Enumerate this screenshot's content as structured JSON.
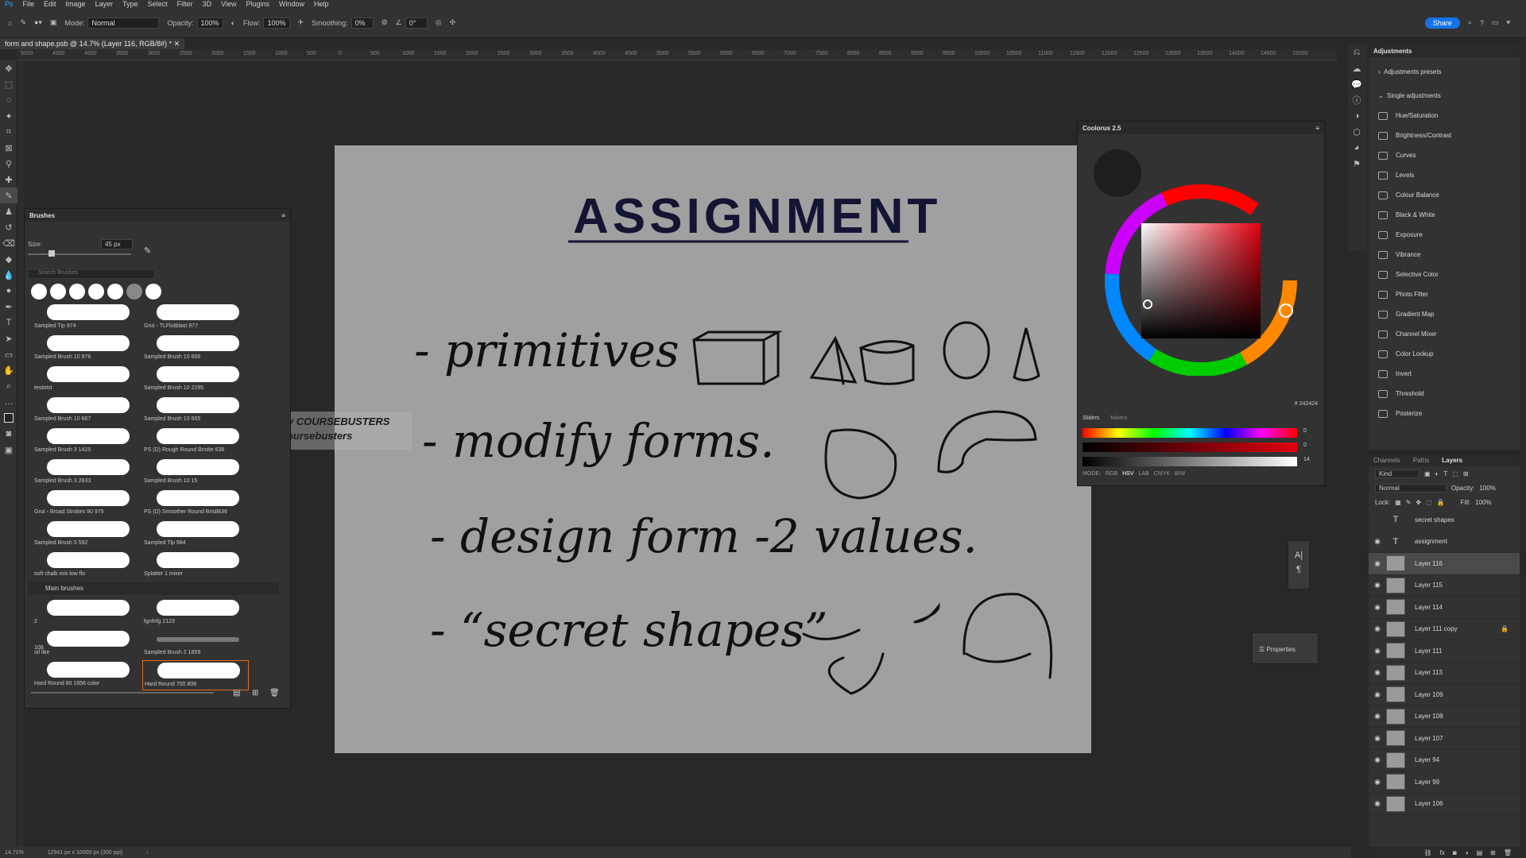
{
  "menu": [
    "File",
    "Edit",
    "Image",
    "Layer",
    "Type",
    "Select",
    "Filter",
    "3D",
    "View",
    "Plugins",
    "Window",
    "Help"
  ],
  "options": {
    "mode_label": "Mode:",
    "mode_value": "Normal",
    "opacity_label": "Opacity:",
    "opacity_value": "100%",
    "flow_label": "Flow:",
    "flow_value": "100%",
    "smoothing_label": "Smoothing:",
    "smoothing_value": "0%",
    "angle_value": "0°",
    "share_label": "Share"
  },
  "document_tab": "form and shape.psb @ 14.7% (Layer 116, RGB/8#) *",
  "ruler_ticks": [
    "5000",
    "4500",
    "4000",
    "3500",
    "3000",
    "2500",
    "2000",
    "1500",
    "1000",
    "500",
    "0",
    "500",
    "1000",
    "1500",
    "2000",
    "2500",
    "3000",
    "3500",
    "4000",
    "4500",
    "5000",
    "5500",
    "6000",
    "6500",
    "7000",
    "7500",
    "8000",
    "8500",
    "9000",
    "9500",
    "10000",
    "10500",
    "11000",
    "11500",
    "12000",
    "12500",
    "13000",
    "13500",
    "14000",
    "14500",
    "15000"
  ],
  "canvas": {
    "title": "ASSIGNMENT",
    "lines": [
      "- primitives",
      "- modify forms.",
      "- design form -2 values.",
      "- “secret shapes”"
    ]
  },
  "brushes_panel": {
    "title": "Brushes",
    "size_label": "Size:",
    "size_value": "45 px",
    "search_placeholder": "Search Brushes",
    "items": [
      "Sampled Tip 974",
      "Grut - TLFlutblast 977",
      "Sampled Brush 10 976",
      "Sampled Brush 10 666",
      "testotst",
      "Sampled Brush 10 2295",
      "Sampled Brush 10 667",
      "Sampled Brush 10 665",
      "Sampled Brush 3 1425",
      "PS (D) Rough Round Bristle 638",
      "Sampled Brush 3 2633",
      "Sampled Brush 10 15",
      "Grut - Broad Strokes 90 975",
      "PS (D) Smoother Round Bristl636",
      "Sampled Brush 3 592",
      "Sampled Tip 984",
      "soft chalk mix low flo",
      "Splatter 1 mixer"
    ],
    "group_label": "Main brushes",
    "group_items": [
      "2",
      "fgnfnfg 2123",
      "oil like",
      "Sampled Brush 2 1859",
      "Hard Round 80 1856 color",
      "Hard Round 700 808"
    ],
    "group_size_labels": [
      "108"
    ]
  },
  "watermark": {
    "line1": "This is a FREE course shared by COURSEBUSTERS",
    "line2": "Join us on telegram  @coursebusters"
  },
  "coolorus": {
    "title": "Coolorus 2.5",
    "hex": "# 242424",
    "tabs": [
      "Sliders",
      "Mixers"
    ],
    "slider_values": [
      "0",
      "0",
      "14"
    ],
    "modes_label": "MODE:",
    "modes": [
      "RGB",
      "HSV",
      "LAB",
      "CMYK",
      "B/W"
    ]
  },
  "adjustments": {
    "title": "Adjustments",
    "presets_label": "Adjustments presets",
    "single_label": "Single adjustments",
    "items": [
      "Hue/Saturation",
      "Brightness/Contrast",
      "Curves",
      "Levels",
      "Colour Balance",
      "Black & White",
      "Exposure",
      "Vibrance",
      "Selective Color",
      "Photo Filter",
      "Gradient Map",
      "Channel Mixer",
      "Color Lookup",
      "Invert",
      "Threshold",
      "Posterize"
    ]
  },
  "layers": {
    "tabs": [
      "Channels",
      "Paths",
      "Layers"
    ],
    "kind_label": "Kind",
    "blend_mode": "Normal",
    "opacity_label": "Opacity:",
    "opacity_value": "100%",
    "lock_label": "Lock:",
    "fill_label": "Fill:",
    "fill_value": "100%",
    "items": [
      "secret shapes",
      "assignment",
      "Layer 116",
      "Layer 115",
      "Layer 114",
      "Layer 111 copy",
      "Layer 111",
      "Layer 113",
      "Layer 109",
      "Layer 108",
      "Layer 107",
      "Layer 94",
      "Layer 99",
      "Layer 106"
    ]
  },
  "properties_label": "Properties",
  "status": {
    "zoom": "14.71%",
    "size": "12941 px x 10000 px (300 ppi)"
  }
}
